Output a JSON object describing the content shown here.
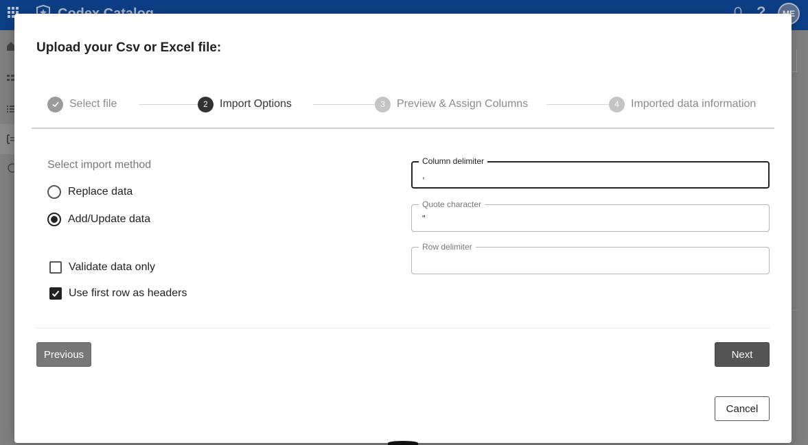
{
  "app": {
    "title": "Codex Catalog",
    "help_symbol": "?",
    "avatar_initials": "ME"
  },
  "dialog": {
    "title": "Upload your Csv or Excel file:",
    "steps": [
      {
        "number": "✓",
        "label": "Select file",
        "state": "done"
      },
      {
        "number": "2",
        "label": "Import Options",
        "state": "active"
      },
      {
        "number": "3",
        "label": "Preview & Assign Columns",
        "state": "pending"
      },
      {
        "number": "4",
        "label": "Imported data information",
        "state": "pending"
      }
    ],
    "import_method": {
      "label": "Select import method",
      "options": [
        {
          "label": "Replace data",
          "selected": false
        },
        {
          "label": "Add/Update data",
          "selected": true
        }
      ]
    },
    "checkboxes": [
      {
        "label": "Validate data only",
        "checked": false
      },
      {
        "label": "Use first row as headers",
        "checked": true
      }
    ],
    "fields": {
      "column_delimiter": {
        "label": "Column delimiter",
        "value": ","
      },
      "quote_character": {
        "label": "Quote character",
        "value": "\""
      },
      "row_delimiter": {
        "label": "Row delimiter",
        "value": ""
      }
    },
    "buttons": {
      "previous": "Previous",
      "next": "Next",
      "cancel": "Cancel"
    }
  },
  "colors": {
    "header_bg": "#0d3f86",
    "primary_dark": "#555555",
    "step_active": "#333333"
  }
}
